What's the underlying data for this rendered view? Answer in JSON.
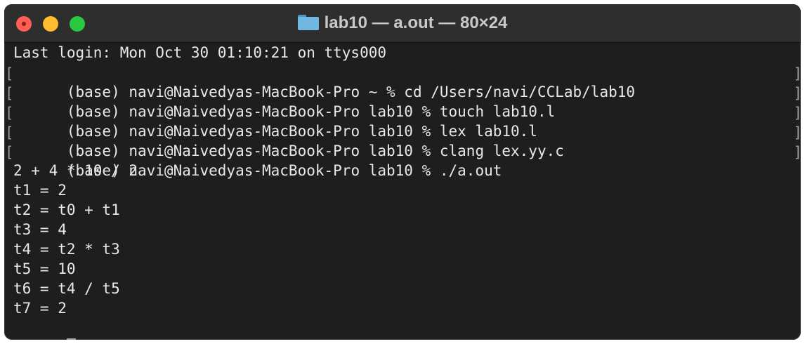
{
  "window": {
    "title": "lab10 — a.out — 80×24",
    "title_icon": "folder-icon"
  },
  "terminal": {
    "login_line": "Last login: Mon Oct 30 01:10:21 on ttys000",
    "commands": [
      "(base) navi@Naivedyas-MacBook-Pro ~ % cd /Users/navi/CCLab/lab10",
      "(base) navi@Naivedyas-MacBook-Pro lab10 % touch lab10.l",
      "(base) navi@Naivedyas-MacBook-Pro lab10 % lex lab10.l",
      "(base) navi@Naivedyas-MacBook-Pro lab10 % clang lex.yy.c",
      "(base) navi@Naivedyas-MacBook-Pro lab10 % ./a.out"
    ],
    "output": [
      "2 + 4 * 10 / 2",
      "t1 = 2",
      "t2 = t0 + t1",
      "t3 = 4",
      "t4 = t2 * t3",
      "t5 = 10",
      "t6 = t4 / t5",
      "t7 = 2"
    ],
    "mark_open": "[",
    "mark_close": "]"
  },
  "colors": {
    "close": "#ff5f57",
    "minimize": "#febc2e",
    "maximize": "#28c840",
    "background": "#1e1e1e",
    "text": "#e8e8e8"
  }
}
